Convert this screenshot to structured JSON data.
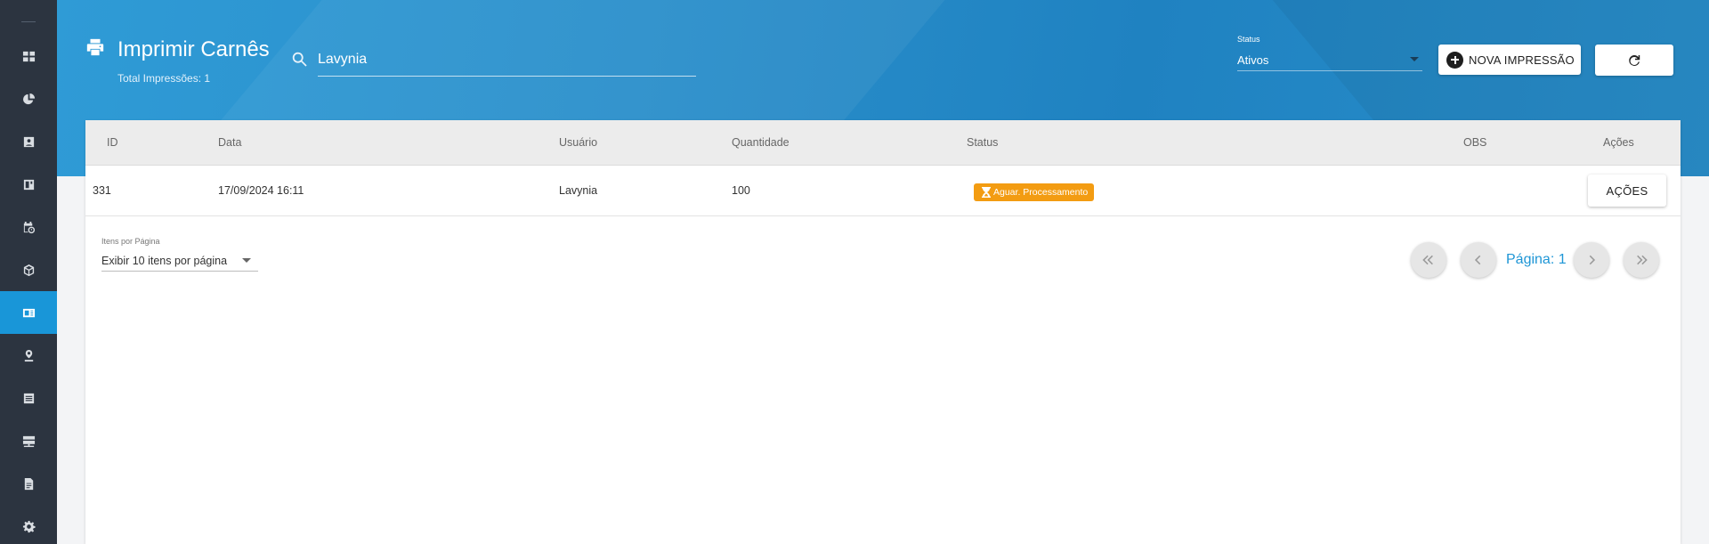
{
  "sidebar": {
    "items": [
      {
        "icon": "dashboard-icon"
      },
      {
        "icon": "pie-chart-icon"
      },
      {
        "icon": "contact-card-icon"
      },
      {
        "icon": "layout-icon"
      },
      {
        "icon": "calendar-clock-icon"
      },
      {
        "icon": "cube-icon"
      },
      {
        "icon": "print-carne-icon",
        "active": true
      },
      {
        "icon": "user-pin-icon"
      },
      {
        "icon": "list-icon"
      },
      {
        "icon": "server-icon"
      },
      {
        "icon": "document-icon"
      },
      {
        "icon": "gear-icon"
      }
    ]
  },
  "header": {
    "title": "Imprimir Carnês",
    "total": "Total Impressões: 1",
    "search": {
      "value": "Lavynia",
      "placeholder": ""
    },
    "status_filter": {
      "label": "Status",
      "value": "Ativos"
    },
    "new_button_label": "NOVA IMPRESSÃO"
  },
  "table": {
    "columns": {
      "id": "ID",
      "data": "Data",
      "usuario": "Usuário",
      "quantidade": "Quantidade",
      "status": "Status",
      "obs": "OBS",
      "acoes": "Ações"
    },
    "rows": [
      {
        "id": "331",
        "data": "17/09/2024 16:11",
        "usuario": "Lavynia",
        "quantidade": "100",
        "status": "Aguar. Processamento",
        "status_color": "#f39c12",
        "obs": "",
        "acoes_label": "AÇÕES"
      }
    ]
  },
  "pagination": {
    "per_page_label": "Itens por Página",
    "per_page_value": "Exibir 10 itens por página",
    "page_label": "Página: 1"
  },
  "colors": {
    "accent": "#1996d8",
    "sidebar_bg": "#2c3440",
    "header_bg": "#2a8fcb",
    "badge": "#f39c12"
  }
}
